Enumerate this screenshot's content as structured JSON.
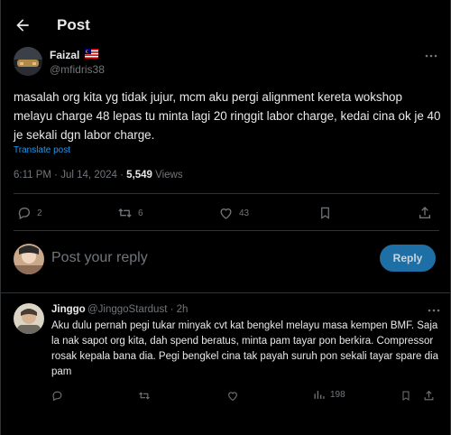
{
  "header": {
    "title": "Post"
  },
  "post": {
    "author_name": "Faizal",
    "author_handle": "@mfidris38",
    "text": "masalah org kita yg tidak jujur, mcm aku pergi alignment kereta wokshop melayu charge 48 lepas tu minta lagi 20 ringgit labor charge, kedai cina ok je 40 je sekali dgn labor charge.",
    "translate_label": "Translate post",
    "time": "6:11 PM",
    "date": "Jul 14, 2024",
    "views_count": "5,549",
    "views_label": "Views",
    "meta_sep": " · ",
    "replies": "2",
    "reposts": "6",
    "likes": "43"
  },
  "composer": {
    "placeholder": "Post your reply",
    "reply_button": "Reply"
  },
  "comment": {
    "author_name": "Jinggo",
    "author_handle": "@JinggoStardust · 2h",
    "text": "Aku dulu pernah pegi tukar minyak cvt kat bengkel melayu masa kempen BMF. Saja la nak sapot org kita, dah spend beratus, minta pam tayar pon berkira. Compressor rosak kepala bana dia. Pegi bengkel cina tak payah suruh pon sekali tayar spare dia pam",
    "views": "198"
  },
  "colors": {
    "background": "#000000",
    "text": "#e7e9ea",
    "muted": "#71767b",
    "accent": "#1d9bf0",
    "divider": "#2f3336"
  },
  "icons": [
    "back-arrow-icon",
    "malaysia-flag-icon",
    "more-icon",
    "reply-icon",
    "repost-icon",
    "like-icon",
    "bookmark-icon",
    "share-icon",
    "views-icon"
  ]
}
